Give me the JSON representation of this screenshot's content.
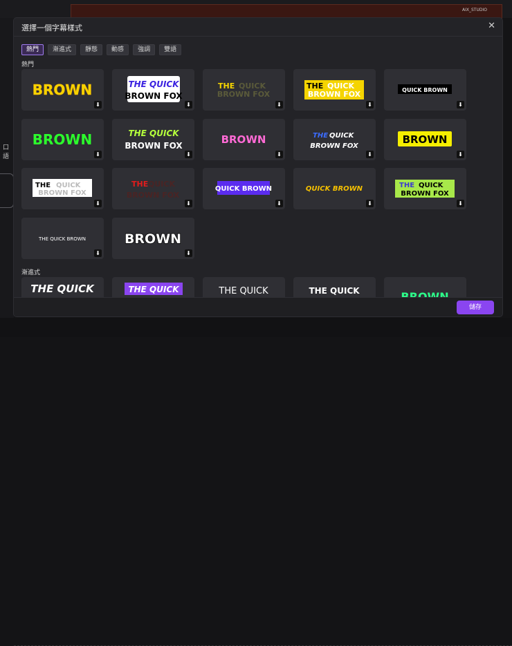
{
  "background": {
    "watermark": "AIX_STUDIO",
    "left_label": "口語"
  },
  "dialog": {
    "title": "選擇一個字幕樣式",
    "tabs": [
      {
        "label": "熱門",
        "active": true
      },
      {
        "label": "漸進式",
        "active": false
      },
      {
        "label": "靜態",
        "active": false
      },
      {
        "label": "動感",
        "active": false
      },
      {
        "label": "強調",
        "active": false
      },
      {
        "label": "雙語",
        "active": false
      }
    ],
    "sections": {
      "popular": "熱門",
      "progressive": "漸進式"
    },
    "save_label": "儲存"
  },
  "cards": {
    "r1c1": {
      "text": "BROWN"
    },
    "r1c2": {
      "line1": "THE QUICK",
      "line2": "BROWN FOX"
    },
    "r1c3": {
      "line1a": "THE",
      "line1b": "QUICK",
      "line2": "BROWN FOX"
    },
    "r1c4": {
      "line1a": "THE",
      "line1b": "QUICK",
      "line2": "BROWN FOX"
    },
    "r1c5": {
      "text": "QUICK BROWN"
    },
    "r2c1": {
      "text": "BROWN"
    },
    "r2c2": {
      "line1": "THE QUICK",
      "line2": "BROWN FOX"
    },
    "r2c3": {
      "text": "BROWN"
    },
    "r2c4": {
      "line1a": "THE",
      "line1b": "QUICK",
      "line2": "BROWN FOX"
    },
    "r2c5": {
      "text": "BROWN"
    },
    "r3c1": {
      "line1a": "THE",
      "line1b": "QUICK",
      "line2": "BROWN FOX"
    },
    "r3c2": {
      "line1a": "THE",
      "line1b": "QUICK",
      "line2": "BROWN FOX"
    },
    "r3c3": {
      "text": "QUICK BROWN"
    },
    "r3c4": {
      "text": "QUICK BROWN"
    },
    "r3c5": {
      "line1a": "THE",
      "line1b": "QUICK",
      "line2": "BROWN FOX"
    },
    "r4c1": {
      "text": "THE QUICK BROWN"
    },
    "r4c2": {
      "text": "BROWN"
    },
    "r5c1": {
      "text": "THE QUICK"
    },
    "r5c2": {
      "text": "THE QUICK"
    },
    "r5c3": {
      "text": "THE QUICK"
    },
    "r5c4": {
      "text": "THE QUICK"
    },
    "r5c5": {
      "text": "BROWN"
    }
  },
  "colors": {
    "accent": "#8a45f0",
    "yellow": "#f5d400",
    "green": "#2cff2c",
    "pink": "#ff6ad5",
    "purple": "#5b2cf0",
    "red": "#e01c1c"
  }
}
